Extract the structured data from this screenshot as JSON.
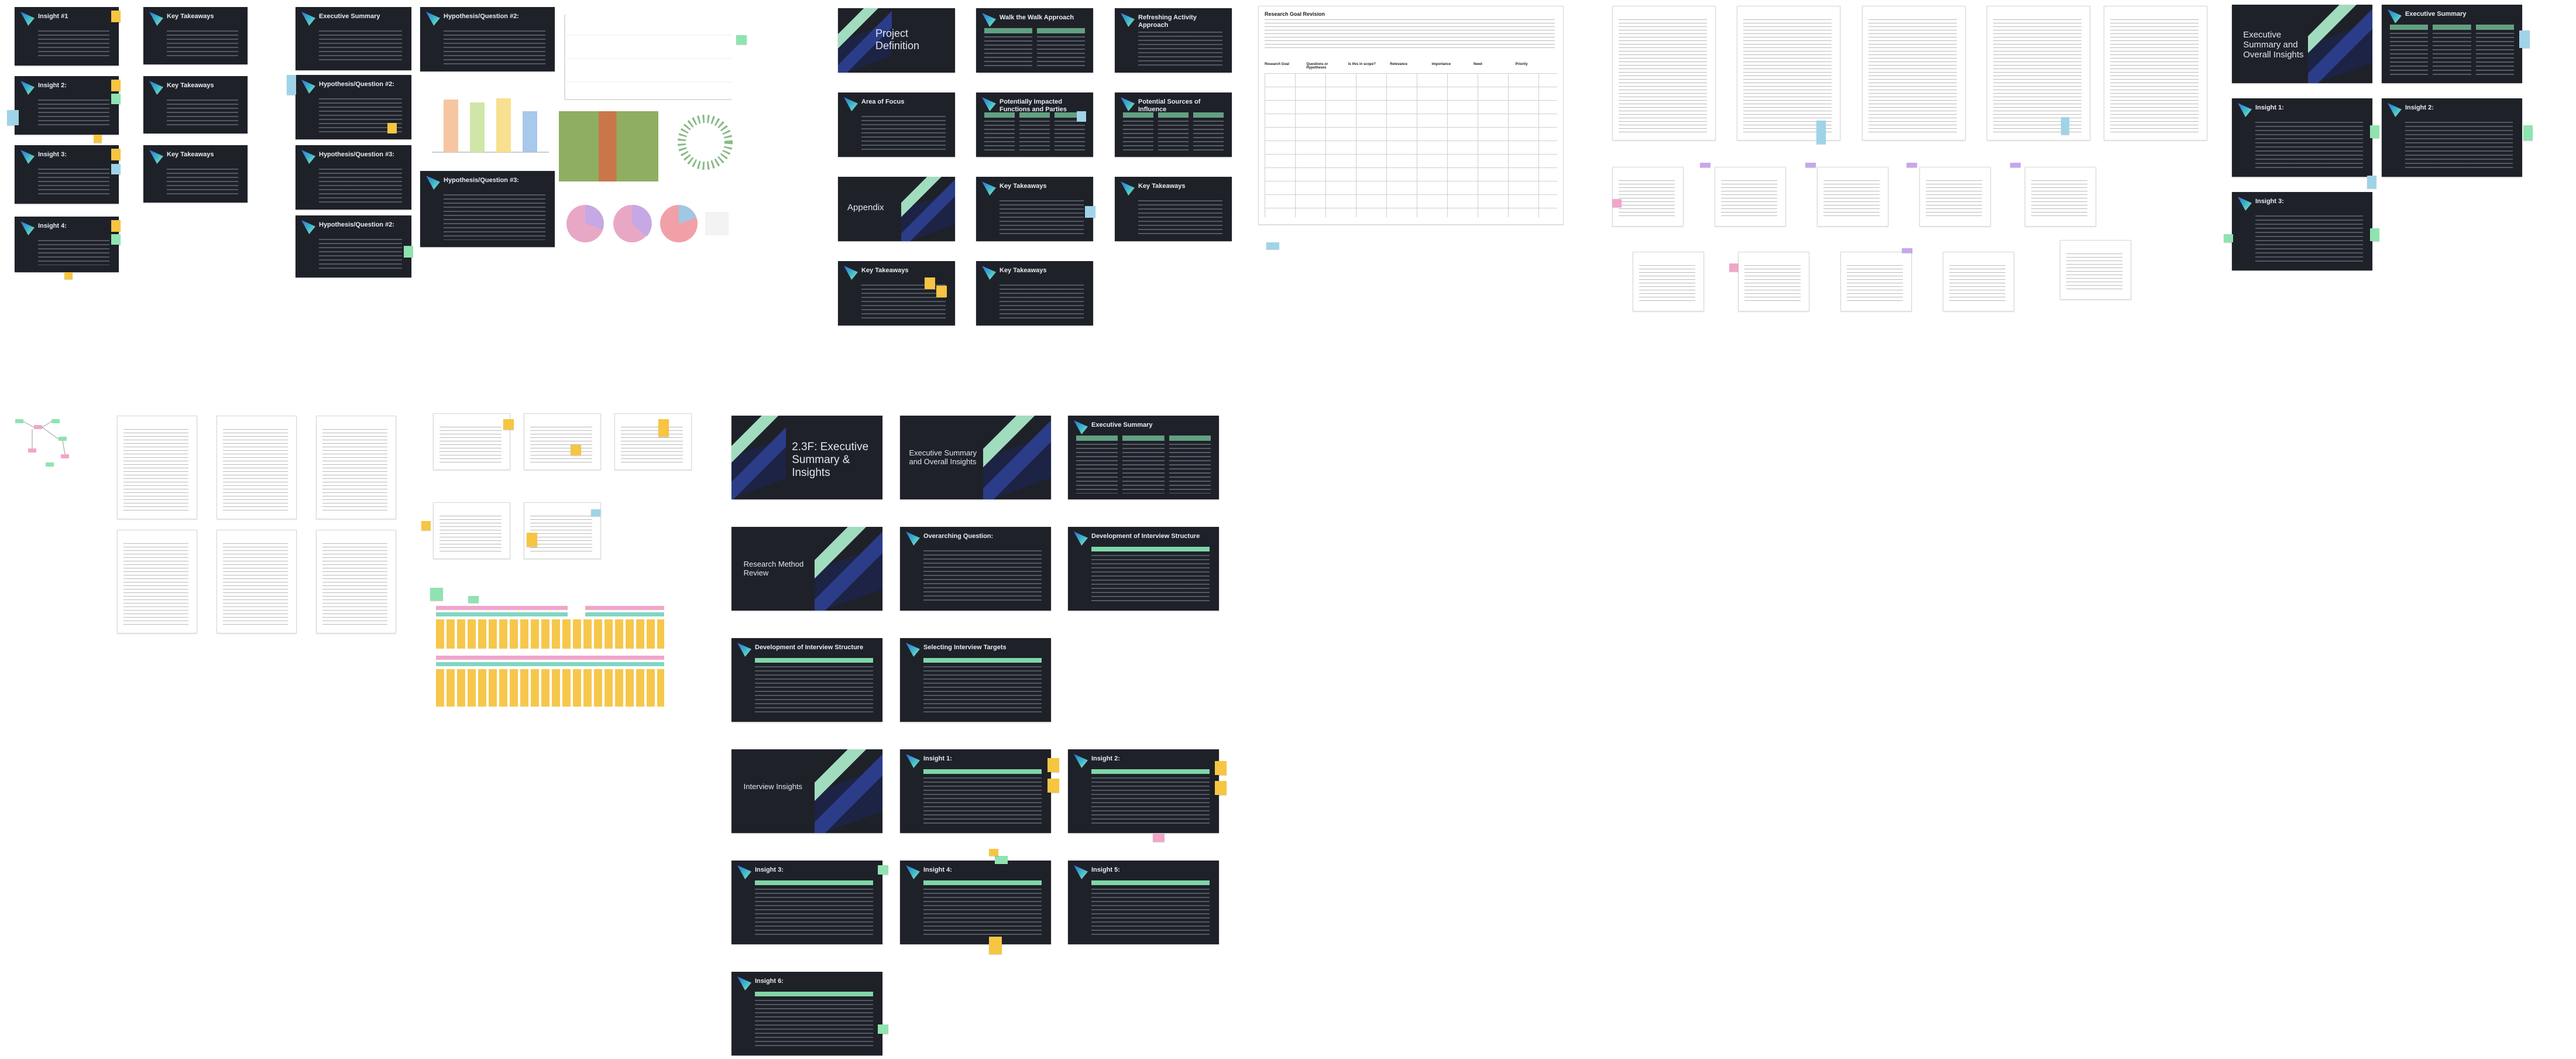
{
  "slides": {
    "project_definition": "Project Definition",
    "scope_of_project": "Area of Focus",
    "appendix": "Appendix",
    "exec_cover": "2.3F: Executive Summary & Insights",
    "exec_overall_1": "Executive Summary and Overall Insights",
    "exec_overall_2": "Executive Summary and Overall Insights",
    "exec_summary_1": "Executive Summary",
    "exec_summary_2": "Executive Summary",
    "research_method": "Research Method Review",
    "overarching_question": "Overarching Question:",
    "dev_interview_1": "Development of Interview Structure",
    "dev_interview_2": "Development of Interview Structure",
    "selecting_targets": "Selecting Interview Targets",
    "interview_insights": "Interview Insights",
    "insight_1": "Insight 1:",
    "insight_2": "Insight 2:",
    "insight_3": "Insight 3:",
    "insight_4": "Insight 4:",
    "insight_5": "Insight 5:",
    "insight_6": "Insight 6:",
    "key_takeaways_1": "Key Takeaways",
    "key_takeaways_2": "Key Takeaways",
    "key_takeaways_3": "Key Takeaways",
    "summary_and_key_takeaways": "Key Takeaways",
    "potential_sources": "Potential Sources of Influence",
    "potential_functions": "Potentially Impacted Functions and Parties",
    "refreshing_activity": "Refreshing Activity Approach",
    "walk_the_walk": "Walk the Walk Approach",
    "hypothesis_q2": "Hypothesis/Question #2:",
    "hypothesis_q3": "Hypothesis/Question #3:",
    "executive_summary_mini": "Executive Summary",
    "insight_label": "Insight #1"
  },
  "doc": {
    "research_goal_revision": "Research Goal Revision"
  },
  "table": {
    "headers": [
      "Research Goal",
      "Questions or Hypotheses",
      "Is this in scope?",
      "Relevance",
      "Importance",
      "Need",
      "Priority"
    ]
  }
}
